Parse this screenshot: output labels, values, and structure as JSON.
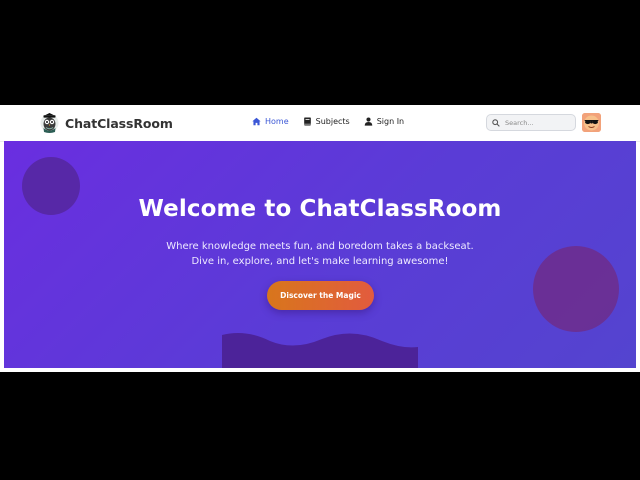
{
  "brand": {
    "name": "ChatClassRoom",
    "logo_icon": "owl-mascot-icon"
  },
  "nav": {
    "items": [
      {
        "label": "Home",
        "icon": "home-icon",
        "active": true
      },
      {
        "label": "Subjects",
        "icon": "book-icon",
        "active": false
      },
      {
        "label": "Sign In",
        "icon": "user-icon",
        "active": false
      }
    ]
  },
  "search": {
    "placeholder": "Search...",
    "value": "",
    "icon": "search-icon"
  },
  "avatar": {
    "icon": "sunglasses-avatar-icon"
  },
  "hero": {
    "title": "Welcome to ChatClassRoom",
    "subtitle_line1": "Where knowledge meets fun, and boredom takes a backseat.",
    "subtitle_line2": "Dive in, explore, and let's make learning awesome!",
    "cta_label": "Discover the Magic"
  },
  "colors": {
    "accent": "#3b57d6",
    "hero_gradient_start": "#6a2ee0",
    "hero_gradient_end": "#5444cf",
    "cta_start": "#d8761c",
    "cta_end": "#e25b3e"
  }
}
